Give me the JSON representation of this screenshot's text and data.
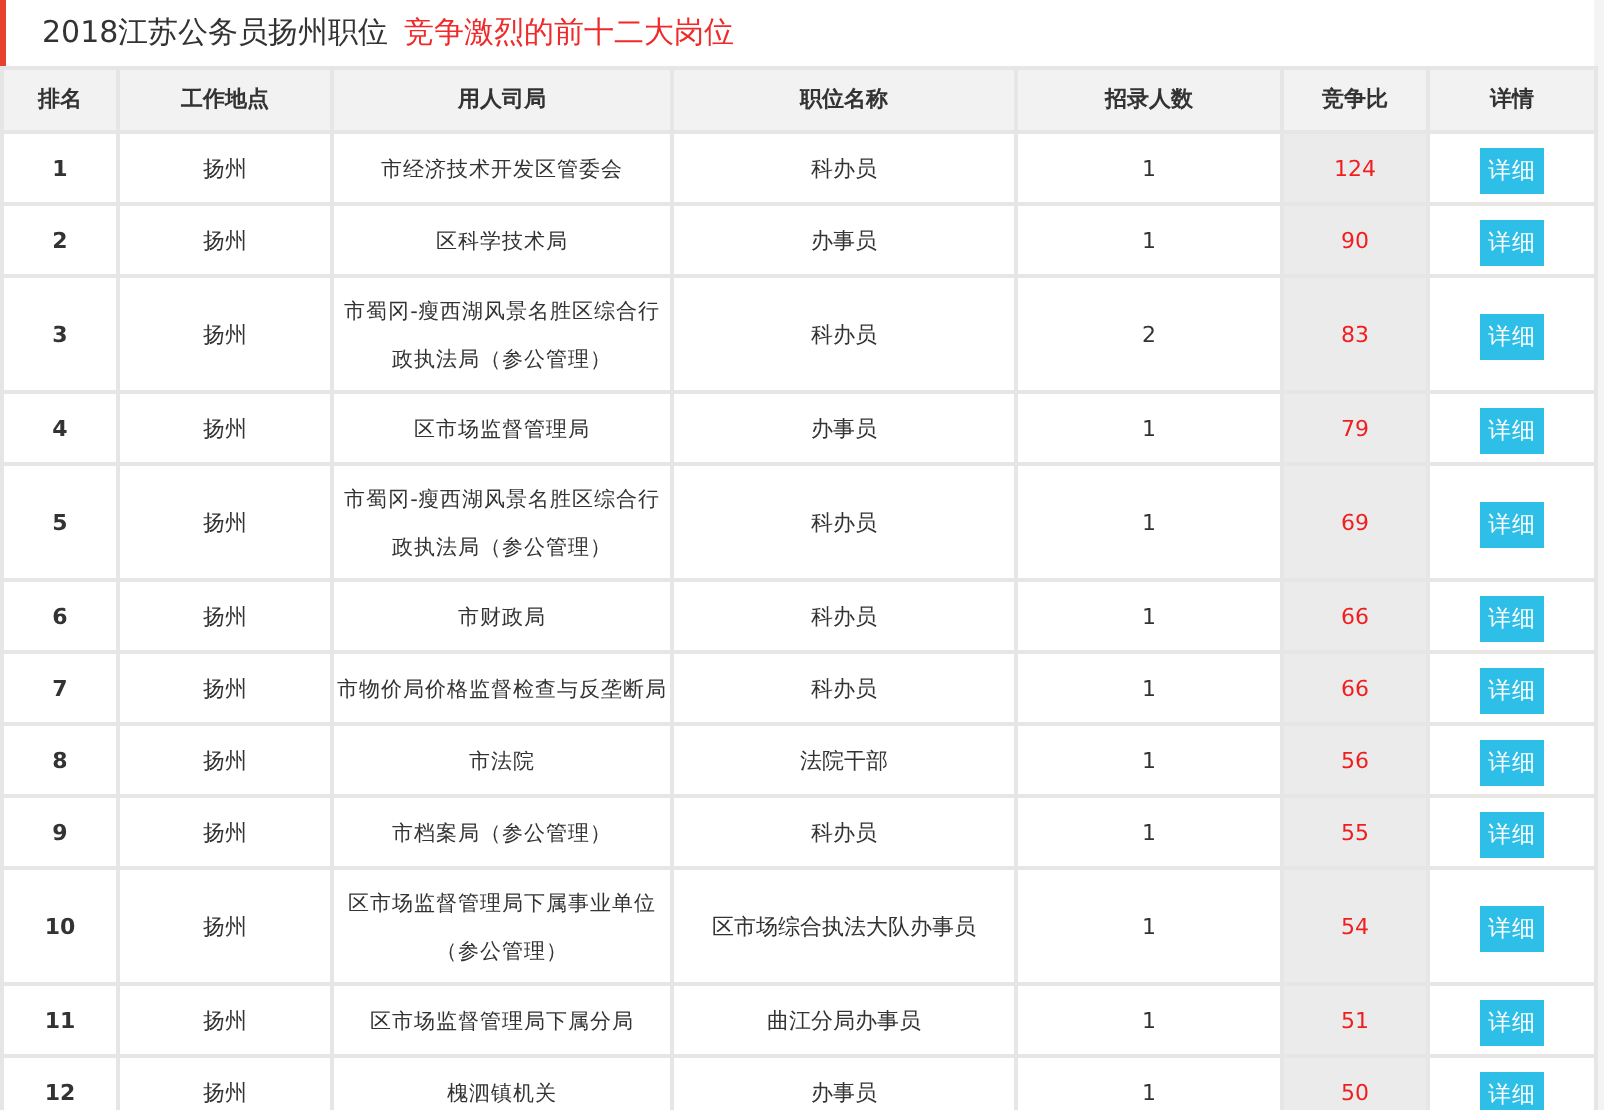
{
  "title": {
    "main": "2018江苏公务员扬州职位",
    "highlight": "竞争激烈的前十二大岗位"
  },
  "table": {
    "columns": [
      "排名",
      "工作地点",
      "用人司局",
      "职位名称",
      "招录人数",
      "竞争比",
      "详情"
    ],
    "rows": [
      {
        "rank": "1",
        "location": "扬州",
        "agency": "市经济技术开发区管委会",
        "position": "科办员",
        "hires": "1",
        "ratio": "124",
        "button": "详细"
      },
      {
        "rank": "2",
        "location": "扬州",
        "agency": "区科学技术局",
        "position": "办事员",
        "hires": "1",
        "ratio": "90",
        "button": "详细"
      },
      {
        "rank": "3",
        "location": "扬州",
        "agency": "市蜀冈-瘦西湖风景名胜区综合行政执法局（参公管理）",
        "position": "科办员",
        "hires": "2",
        "ratio": "83",
        "button": "详细"
      },
      {
        "rank": "4",
        "location": "扬州",
        "agency": "区市场监督管理局",
        "position": "办事员",
        "hires": "1",
        "ratio": "79",
        "button": "详细"
      },
      {
        "rank": "5",
        "location": "扬州",
        "agency": "市蜀冈-瘦西湖风景名胜区综合行政执法局（参公管理）",
        "position": "科办员",
        "hires": "1",
        "ratio": "69",
        "button": "详细"
      },
      {
        "rank": "6",
        "location": "扬州",
        "agency": "市财政局",
        "position": "科办员",
        "hires": "1",
        "ratio": "66",
        "button": "详细"
      },
      {
        "rank": "7",
        "location": "扬州",
        "agency": "市物价局价格监督检查与反垄断局",
        "position": "科办员",
        "hires": "1",
        "ratio": "66",
        "button": "详细"
      },
      {
        "rank": "8",
        "location": "扬州",
        "agency": "市法院",
        "position": "法院干部",
        "hires": "1",
        "ratio": "56",
        "button": "详细"
      },
      {
        "rank": "9",
        "location": "扬州",
        "agency": "市档案局（参公管理）",
        "position": "科办员",
        "hires": "1",
        "ratio": "55",
        "button": "详细"
      },
      {
        "rank": "10",
        "location": "扬州",
        "agency": "区市场监督管理局下属事业单位（参公管理）",
        "position": "区市场综合执法大队办事员",
        "hires": "1",
        "ratio": "54",
        "button": "详细"
      },
      {
        "rank": "11",
        "location": "扬州",
        "agency": "区市场监督管理局下属分局",
        "position": "曲江分局办事员",
        "hires": "1",
        "ratio": "51",
        "button": "详细"
      },
      {
        "rank": "12",
        "location": "扬州",
        "agency": "槐泗镇机关",
        "position": "办事员",
        "hires": "1",
        "ratio": "50",
        "button": "详细"
      }
    ]
  }
}
